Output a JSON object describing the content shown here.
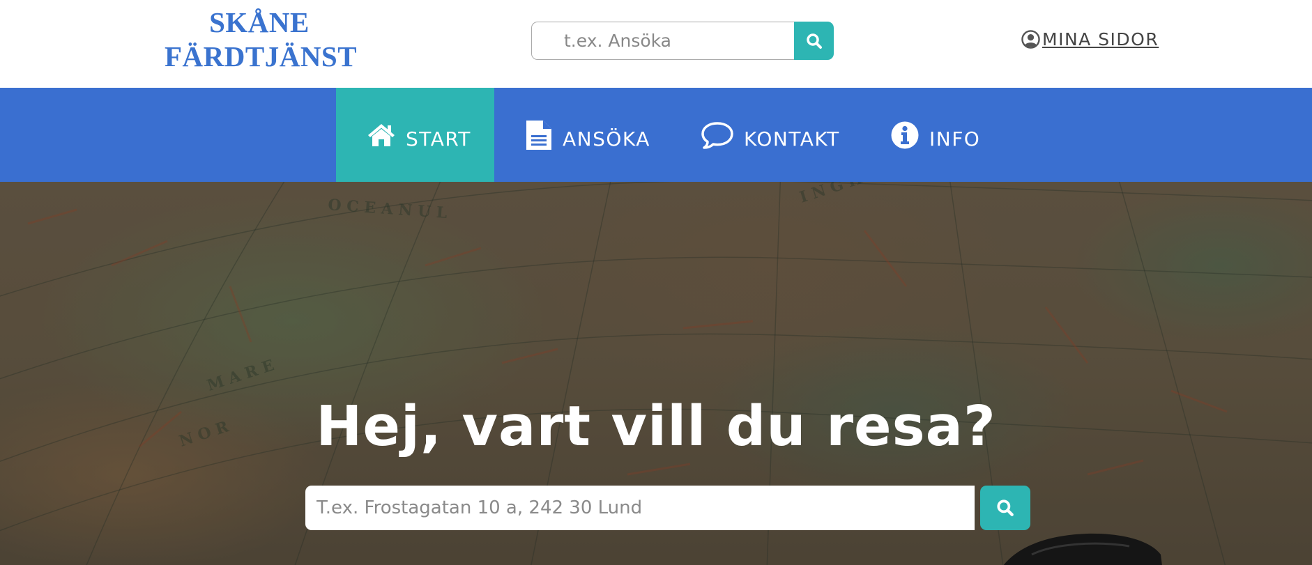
{
  "header": {
    "logo_line1": "SKÅNE",
    "logo_line2": "FÄRDTJÄNST",
    "search": {
      "placeholder": "t.ex. Ansöka",
      "button_icon": "search-icon"
    },
    "account": {
      "label": "MINA SIDOR",
      "icon": "user-circle-icon"
    }
  },
  "nav": {
    "items": [
      {
        "label": "START",
        "icon": "home-icon",
        "active": true
      },
      {
        "label": "ANSÖKA",
        "icon": "document-icon",
        "active": false
      },
      {
        "label": "KONTAKT",
        "icon": "speech-bubble-icon",
        "active": false
      },
      {
        "label": "INFO",
        "icon": "info-icon",
        "active": false
      }
    ]
  },
  "hero": {
    "title": "Hej, vart vill du resa?",
    "search": {
      "placeholder": "T.ex. Frostagatan 10 a, 242 30 Lund",
      "button_icon": "search-icon"
    }
  },
  "colors": {
    "brand_blue": "#3a73cf",
    "nav_blue": "#3a6fd0",
    "accent_teal": "#2db5b3"
  }
}
